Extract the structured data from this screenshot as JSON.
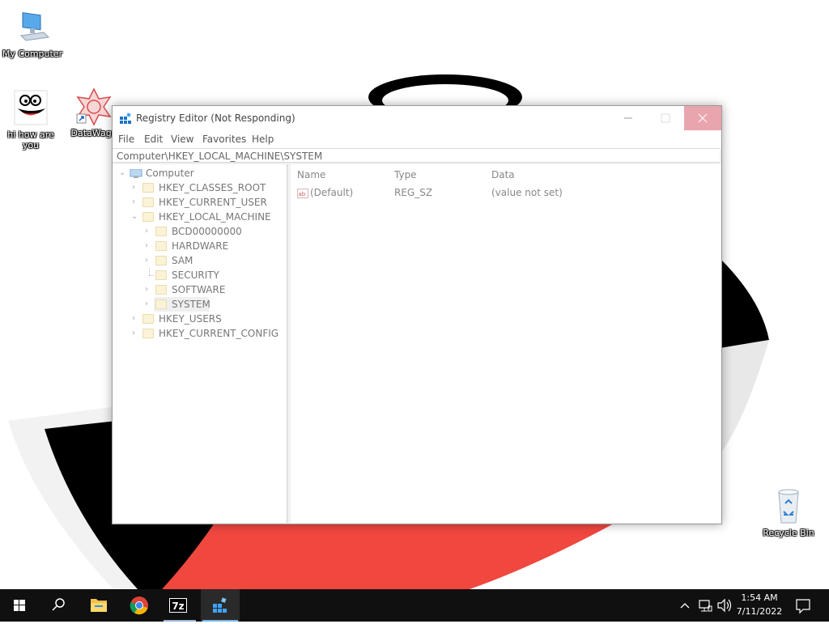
{
  "desktop": {
    "icons": [
      {
        "label": "My Computer"
      },
      {
        "label": "hi how are you"
      },
      {
        "label": "DataWago"
      },
      {
        "label": "Recycle Bin"
      }
    ]
  },
  "window": {
    "title": "Registry Editor (Not Responding)",
    "menu": [
      "File",
      "Edit",
      "View",
      "Favorites",
      "Help"
    ],
    "address": "Computer\\HKEY_LOCAL_MACHINE\\SYSTEM",
    "tree": {
      "root": "Computer",
      "nodes": [
        "HKEY_CLASSES_ROOT",
        "HKEY_CURRENT_USER",
        "HKEY_LOCAL_MACHINE",
        "BCD00000000",
        "HARDWARE",
        "SAM",
        "SECURITY",
        "SOFTWARE",
        "SYSTEM",
        "HKEY_USERS",
        "HKEY_CURRENT_CONFIG"
      ],
      "selected": "SYSTEM"
    },
    "list": {
      "columns": [
        "Name",
        "Type",
        "Data"
      ],
      "rows": [
        {
          "name": "(Default)",
          "type": "REG_SZ",
          "data": "(value not set)"
        }
      ]
    }
  },
  "taskbar": {
    "icons": [
      "windows-start-icon",
      "search-icon",
      "file-explorer-icon",
      "chrome-icon",
      "7zip-icon",
      "registry-editor-icon"
    ],
    "seven_zip_label": "7z",
    "time": "1:54 AM",
    "date": "7/11/2022"
  },
  "colors": {
    "taskbar": "#101010",
    "close_hover": "#e9a5ad",
    "wallpaper_red": "#f0473f"
  }
}
